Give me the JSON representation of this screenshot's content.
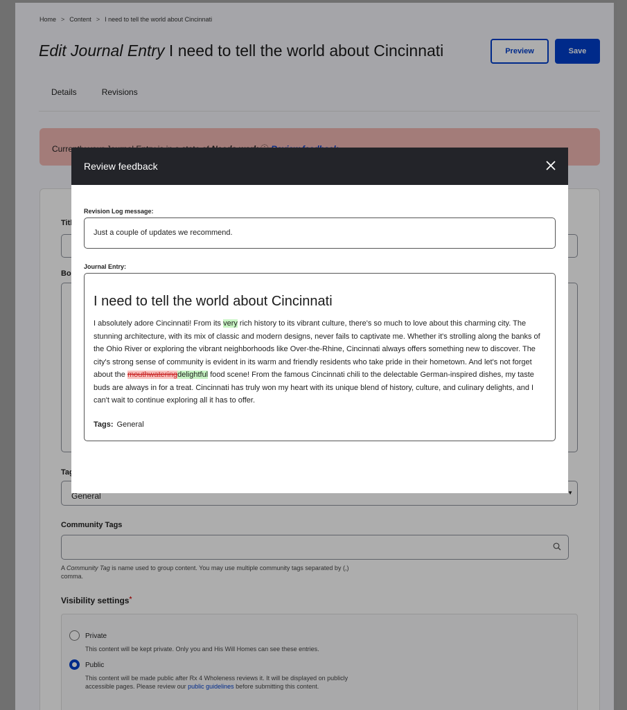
{
  "breadcrumb": {
    "home": "Home",
    "sep": ">",
    "content": "Content",
    "current": "I need to tell the world about Cincinnati"
  },
  "page": {
    "title_prefix": "Edit Journal Entry",
    "title_text": "I need to tell the world about Cincinnati"
  },
  "buttons": {
    "preview": "Preview",
    "save": "Save"
  },
  "tabs": [
    {
      "label": "Details"
    },
    {
      "label": "Revisions"
    }
  ],
  "alert": {
    "text_start": "Currently your Journal Entry is in a state of",
    "state": "Needs work",
    "link": "Review feedback"
  },
  "form": {
    "title_label": "Title",
    "body_label": "Body",
    "tags_label": "Tags",
    "tags_value": "General",
    "community_tags_label": "Community Tags",
    "community_tags_hint_pre": "A",
    "community_tags_hint_em": "Community Tag",
    "community_tags_hint_post": "is name used to group content. You may use multiple community tags separated by (,) comma.",
    "visibility_label": "Visibility settings",
    "required_mark": "*",
    "visibility_options": [
      {
        "label": "Private",
        "desc": "This content will be kept private. Only you and His Will Homes can see these entries."
      },
      {
        "label": "Public",
        "desc_pre": "This content will be made public after Rx 4 Wholeness reviews it. It will be displayed on publicly accessible pages. Please review our",
        "desc_link": "public guidelines",
        "desc_post": "before submitting this content."
      }
    ],
    "visibility_selected": "Public"
  },
  "modal": {
    "title": "Review feedback",
    "revision_label": "Revision Log message:",
    "revision_text": "Just a couple of updates we recommend.",
    "entry_label": "Journal Entry:",
    "entry_title": "I need to tell the world about Cincinnati",
    "body_p1": "I absolutely adore Cincinnati! From its ",
    "inserted_1": "very",
    "body_p2": " rich history to its vibrant culture, there's so much to love about this charming city. The stunning architecture, with its mix of classic and modern designs, never fails to captivate me. Whether it's strolling along the banks of the Ohio River or exploring the vibrant neighborhoods like Over-the-Rhine, Cincinnati always offers something new to discover. The city's strong sense of community is evident in its warm and friendly residents who take pride in their hometown. And let's not forget about the ",
    "deleted_1": "mouthwatering",
    "inserted_2": "delightful",
    "body_p3": " food scene! From the famous Cincinnati chili to the delectable German-inspired dishes, my taste buds are always in for a treat. Cincinnati has truly won my heart with its unique blend of history, culture, and culinary delights, and I can't wait to continue exploring all it has to offer.",
    "tags_label": "Tags:",
    "tags_value": "General"
  },
  "colors": {
    "primary": "#003ecc",
    "alert_bg": "#f0b7b3",
    "modal_header": "#232429",
    "insert_bg": "#c8f5c4",
    "delete_bg": "#f8c4c1"
  }
}
